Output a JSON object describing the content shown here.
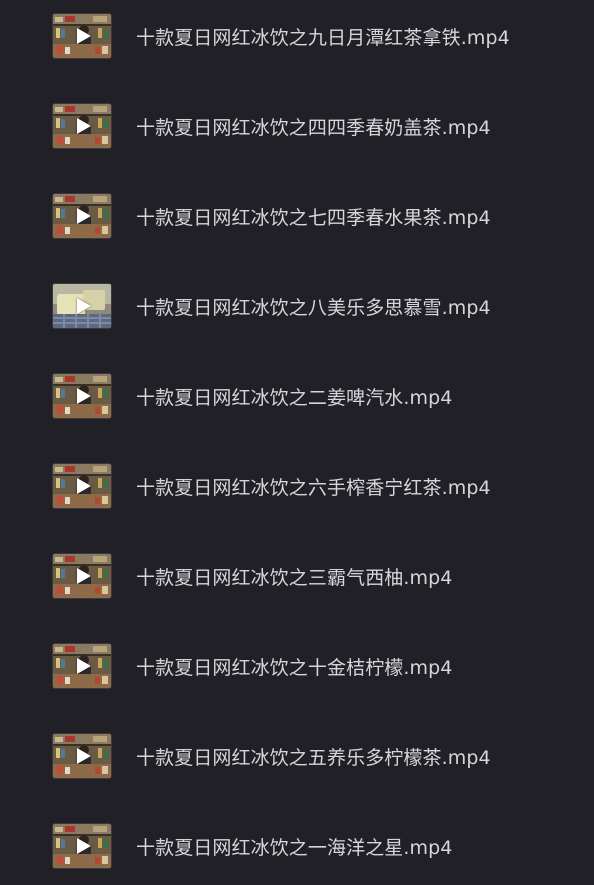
{
  "files": [
    {
      "name": "十款夏日网红冰饮之九日月潭红茶拿铁.mp4",
      "thumb": "thumbnail-bar-scene"
    },
    {
      "name": "十款夏日网红冰饮之四四季春奶盖茶.mp4",
      "thumb": "thumbnail-bar-scene"
    },
    {
      "name": "十款夏日网红冰饮之七四季春水果茶.mp4",
      "thumb": "thumbnail-bar-scene"
    },
    {
      "name": "十款夏日网红冰饮之八美乐多思慕雪.mp4",
      "thumb": "thumbnail-closeup-scene"
    },
    {
      "name": "十款夏日网红冰饮之二姜啤汽水.mp4",
      "thumb": "thumbnail-bar-scene"
    },
    {
      "name": "十款夏日网红冰饮之六手榨香宁红茶.mp4",
      "thumb": "thumbnail-bar-scene"
    },
    {
      "name": "十款夏日网红冰饮之三霸气西柚.mp4",
      "thumb": "thumbnail-bar-scene"
    },
    {
      "name": "十款夏日网红冰饮之十金桔柠檬.mp4",
      "thumb": "thumbnail-bar-scene"
    },
    {
      "name": "十款夏日网红冰饮之五养乐多柠檬茶.mp4",
      "thumb": "thumbnail-bar-scene"
    },
    {
      "name": "十款夏日网红冰饮之一海洋之星.mp4",
      "thumb": "thumbnail-bar-scene"
    }
  ],
  "colors": {
    "background": "#212026",
    "text": "#d6d5da"
  }
}
